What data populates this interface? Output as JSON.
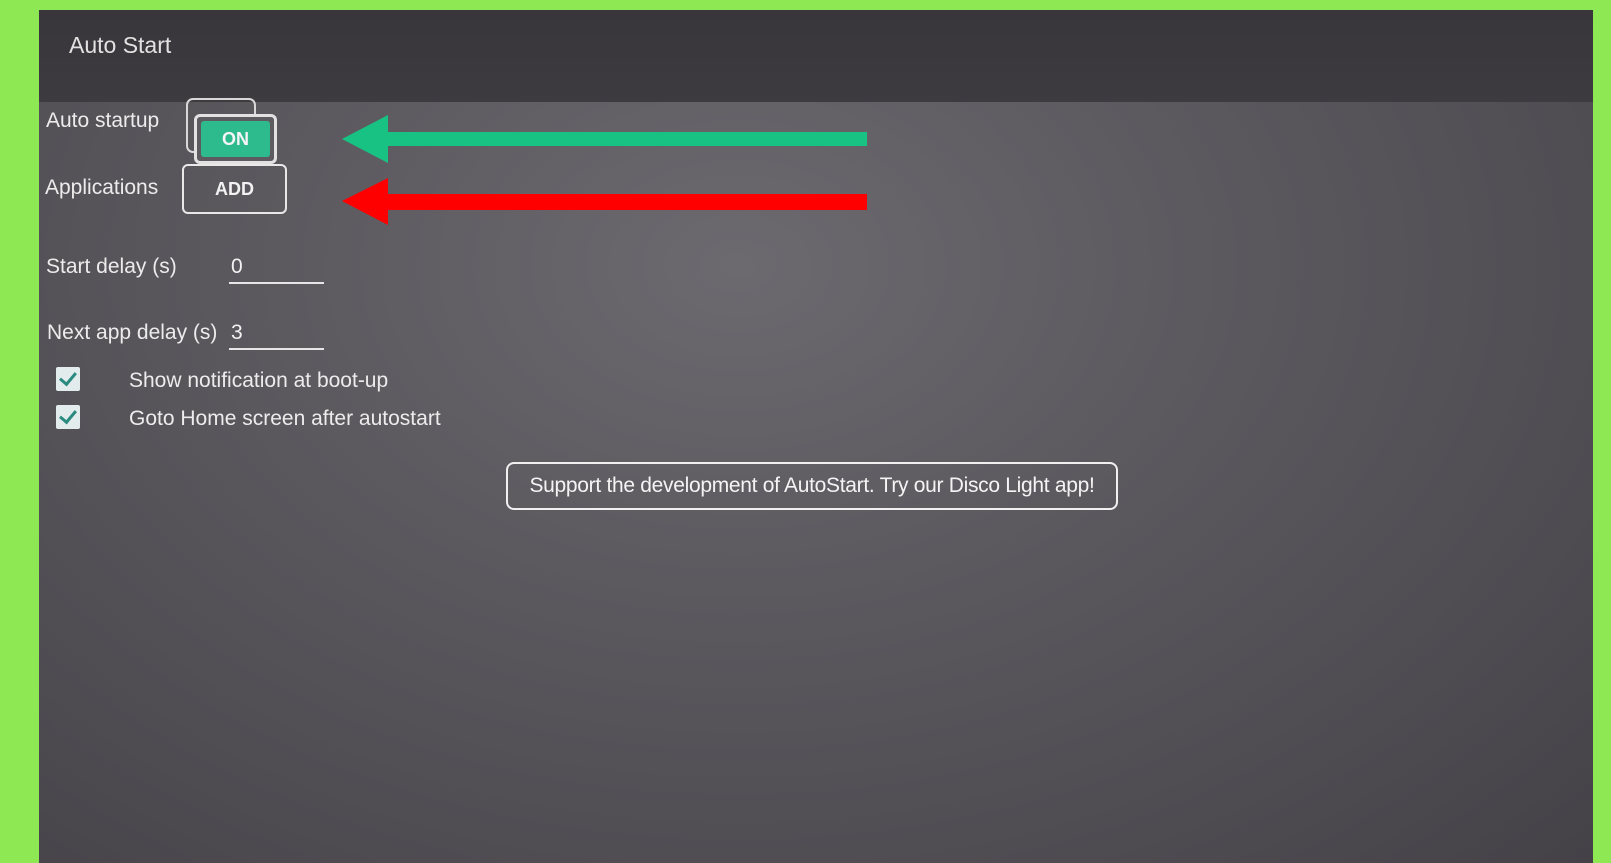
{
  "app": {
    "title": "Auto Start"
  },
  "settings": {
    "auto_startup": {
      "label": "Auto startup",
      "toggle_label": "ON"
    },
    "applications": {
      "label": "Applications",
      "button_label": "ADD"
    },
    "start_delay": {
      "label": "Start delay (s)",
      "value": "0"
    },
    "next_app_delay": {
      "label": "Next app delay (s)",
      "value": "3"
    },
    "checkboxes": [
      {
        "label": "Show notification at boot-up",
        "checked": true
      },
      {
        "label": "Goto Home screen after autostart",
        "checked": true
      }
    ]
  },
  "banner": {
    "text": "Support the development of AutoStart. Try our Disco Light app!"
  },
  "annotations": {
    "arrow_1_color": "#17c283",
    "arrow_2_color": "#ff0000"
  },
  "colors": {
    "background_frame": "#8ee854",
    "toggle_on": "#2dbb8e",
    "screen": "#5d5b60"
  }
}
